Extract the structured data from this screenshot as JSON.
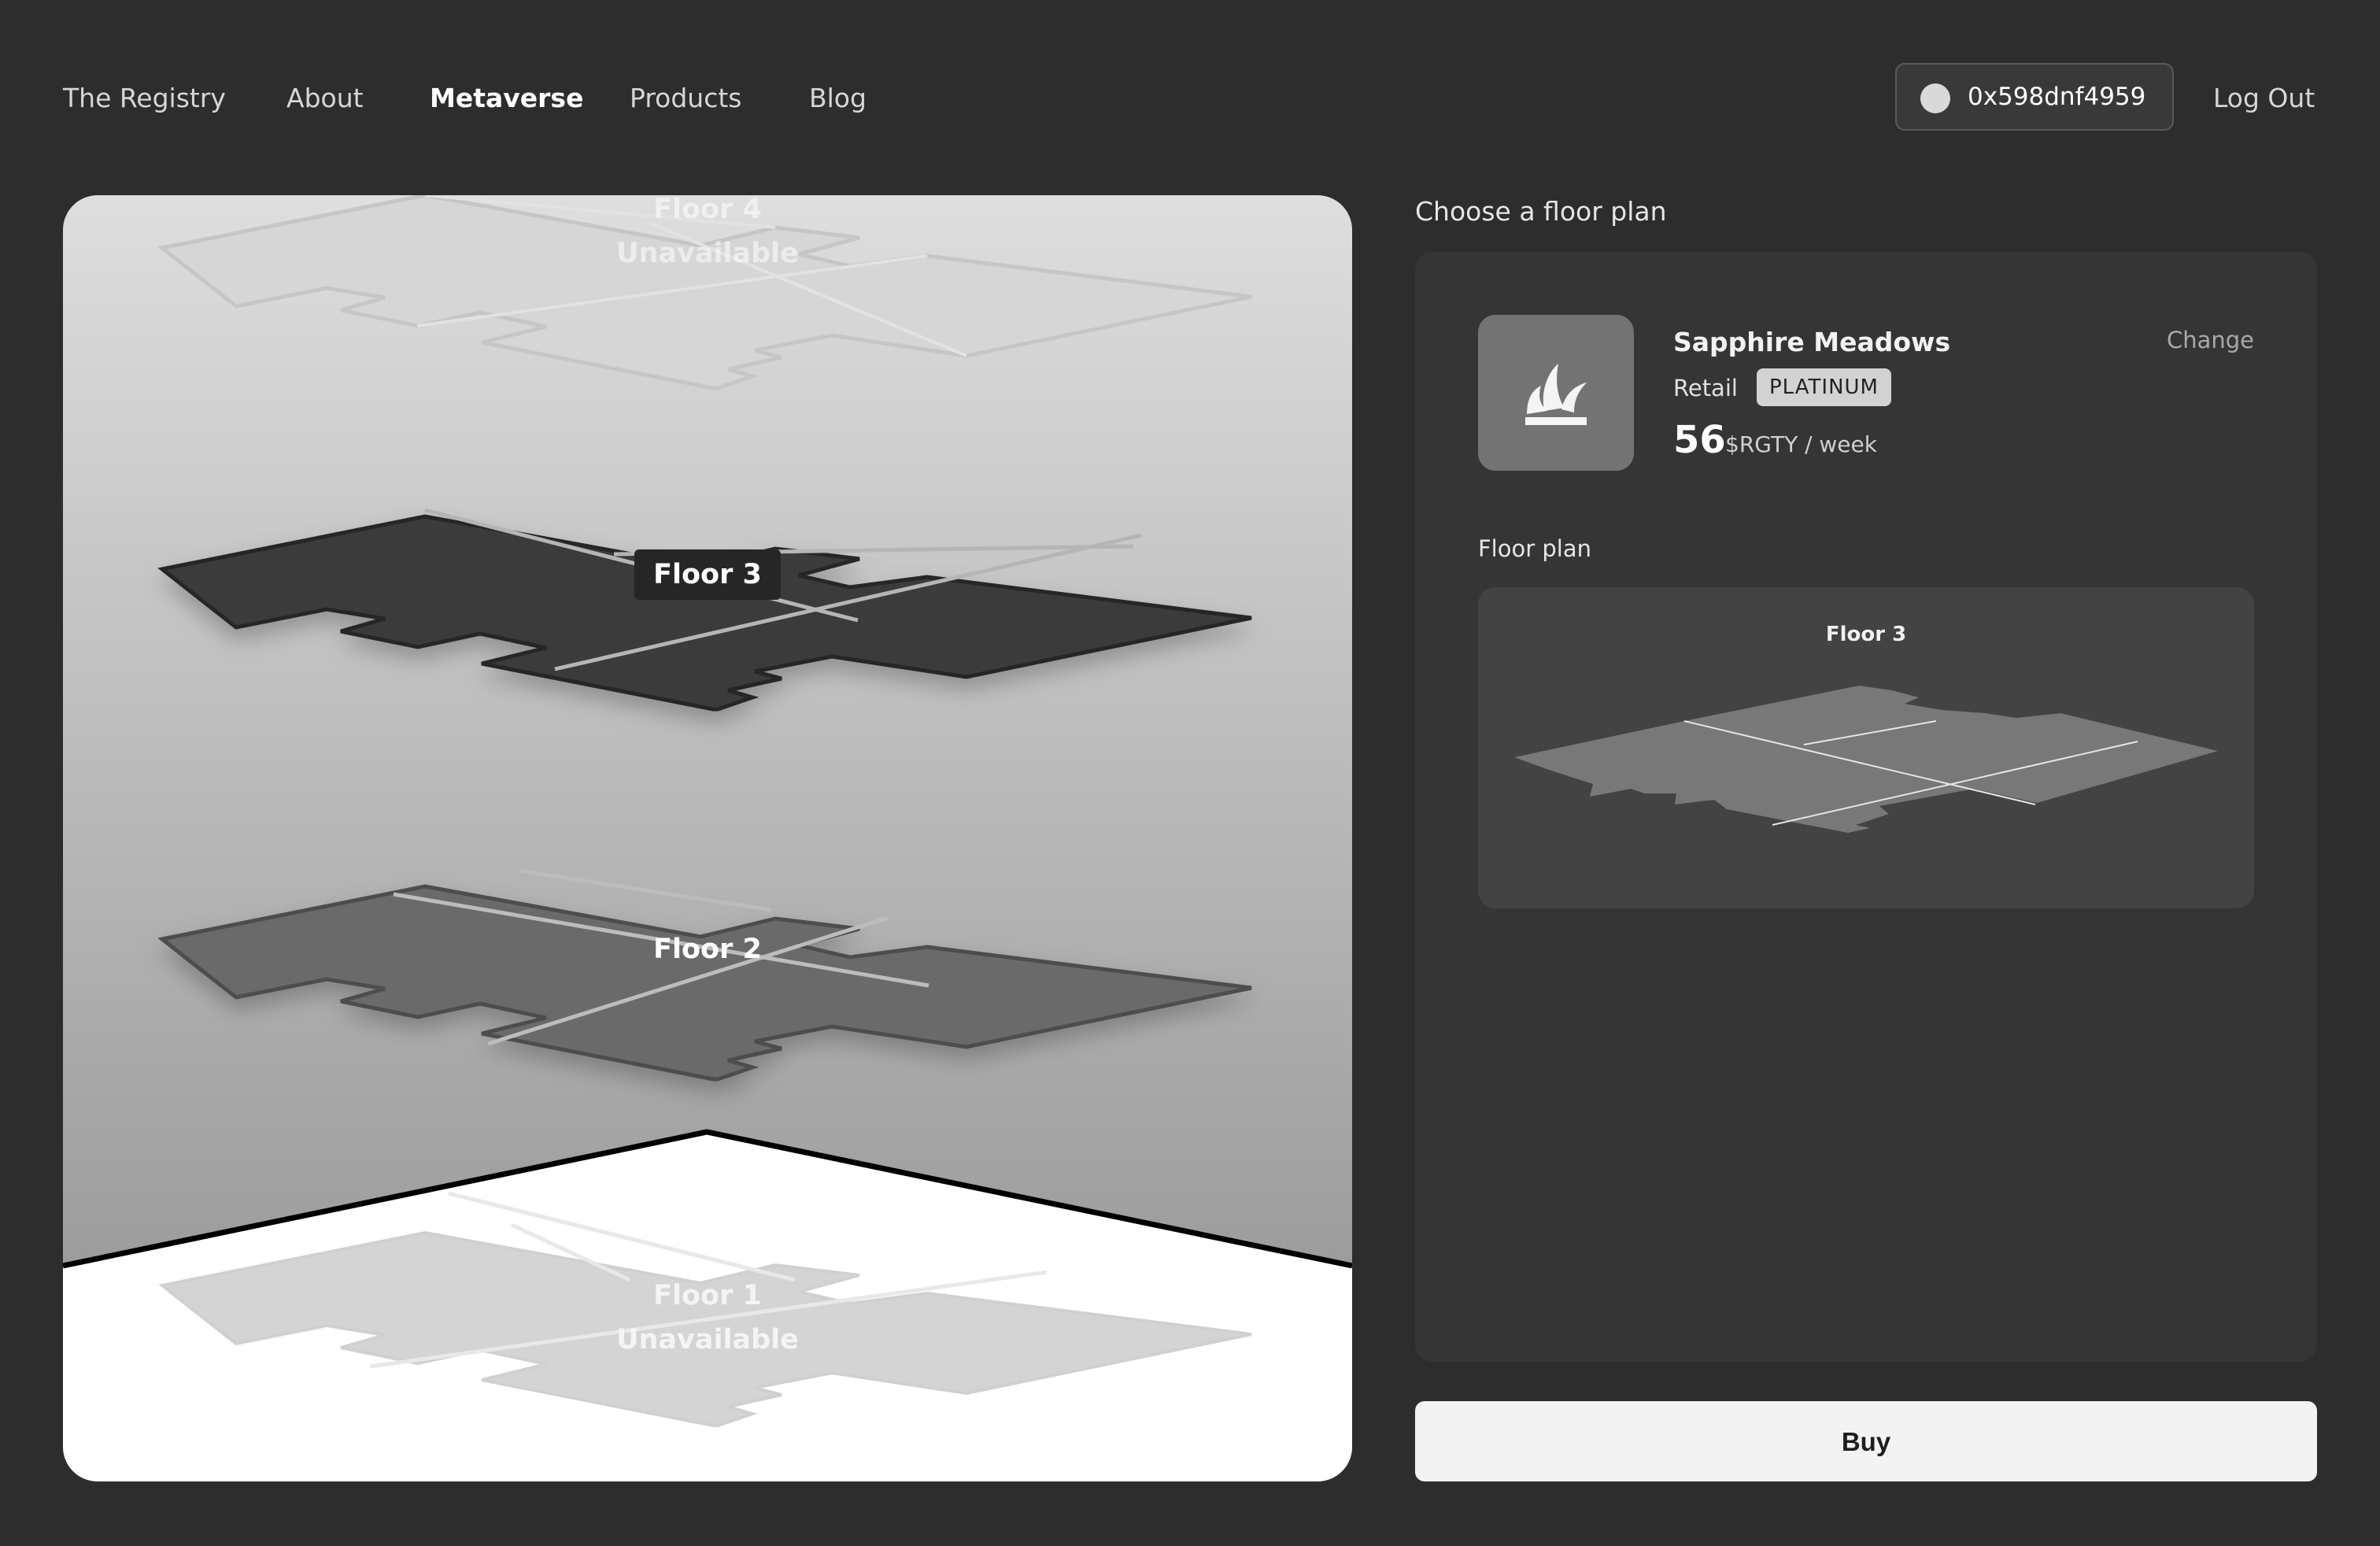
{
  "nav": {
    "links": [
      {
        "label": "The Registry",
        "active": false
      },
      {
        "label": "About",
        "active": false
      },
      {
        "label": "Metaverse",
        "active": true
      },
      {
        "label": "Products",
        "active": false
      },
      {
        "label": "Blog",
        "active": false
      }
    ],
    "wallet_address": "0x598dnf4959",
    "logout_label": "Log Out"
  },
  "viewer": {
    "floors": [
      {
        "name": "Floor 4",
        "status": "Unavailable",
        "selected": false
      },
      {
        "name": "Floor 3",
        "status": "",
        "selected": true
      },
      {
        "name": "Floor 2",
        "status": "",
        "selected": false
      },
      {
        "name": "Floor 1",
        "status": "Unavailable",
        "selected": false
      }
    ]
  },
  "panel": {
    "title": "Choose a floor plan",
    "product": {
      "name": "Sapphire Meadows",
      "category": "Retail",
      "tier": "PLATINUM",
      "price": "56",
      "price_unit": "$RGTY / week",
      "change_label": "Change",
      "icon": "grass-leaves-icon"
    },
    "floor_plan_label": "Floor plan",
    "floor_plan_preview_title": "Floor 3"
  },
  "buy_label": "Buy",
  "colors": {
    "background": "#2d2d2d",
    "panel": "#353535",
    "selected_floor": "#3a3a3a",
    "floor_2": "#6b6b6b",
    "unavailable_floor": "#d4d4d4"
  }
}
